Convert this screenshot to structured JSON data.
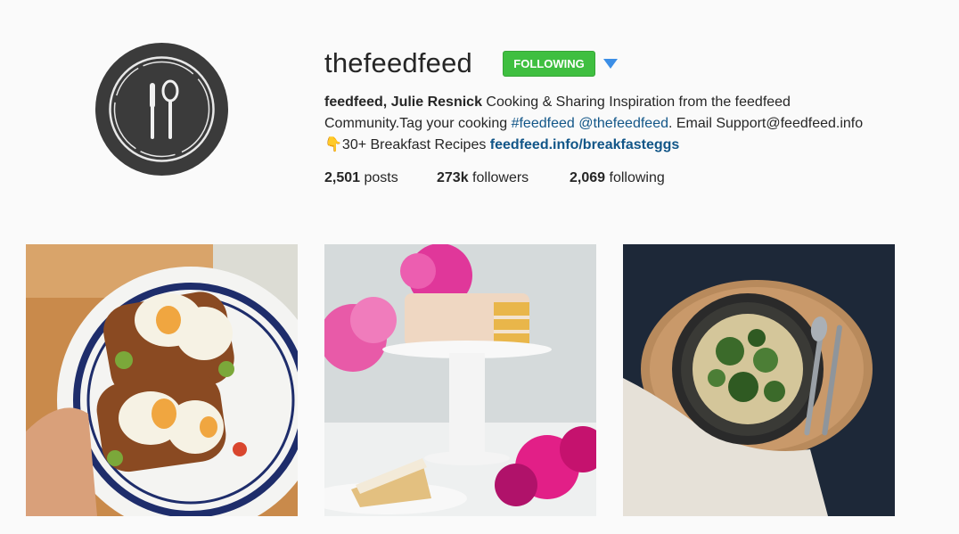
{
  "profile": {
    "username": "thefeedfeed",
    "follow_label": "FOLLOWING",
    "bio": {
      "full_name": "feedfeed, Julie Resnick",
      "line1_rest": " Cooking & Sharing Inspiration from the feedfeed",
      "line2_prefix": "Community.Tag your cooking ",
      "hashtag": "#feedfeed",
      "mention": "@thefeedfeed",
      "line2_suffix": ". Email Support@feedfeed.info",
      "line3_emoji": "👇",
      "line3_text": "30+ Breakfast Recipes ",
      "line3_link": "feedfeed.info/breakfasteggs"
    },
    "stats": {
      "posts_count": "2,501",
      "posts_label": "posts",
      "followers_count": "273k",
      "followers_label": "followers",
      "following_count": "2,069",
      "following_label": "following"
    }
  },
  "colors": {
    "follow_green": "#3fbf40",
    "link_blue": "#125688",
    "dropdown_blue": "#3b8ee6"
  },
  "posts": [
    {
      "subject": "poached eggs on toast"
    },
    {
      "subject": "cake on stand with peonies"
    },
    {
      "subject": "pasta with greens"
    }
  ]
}
